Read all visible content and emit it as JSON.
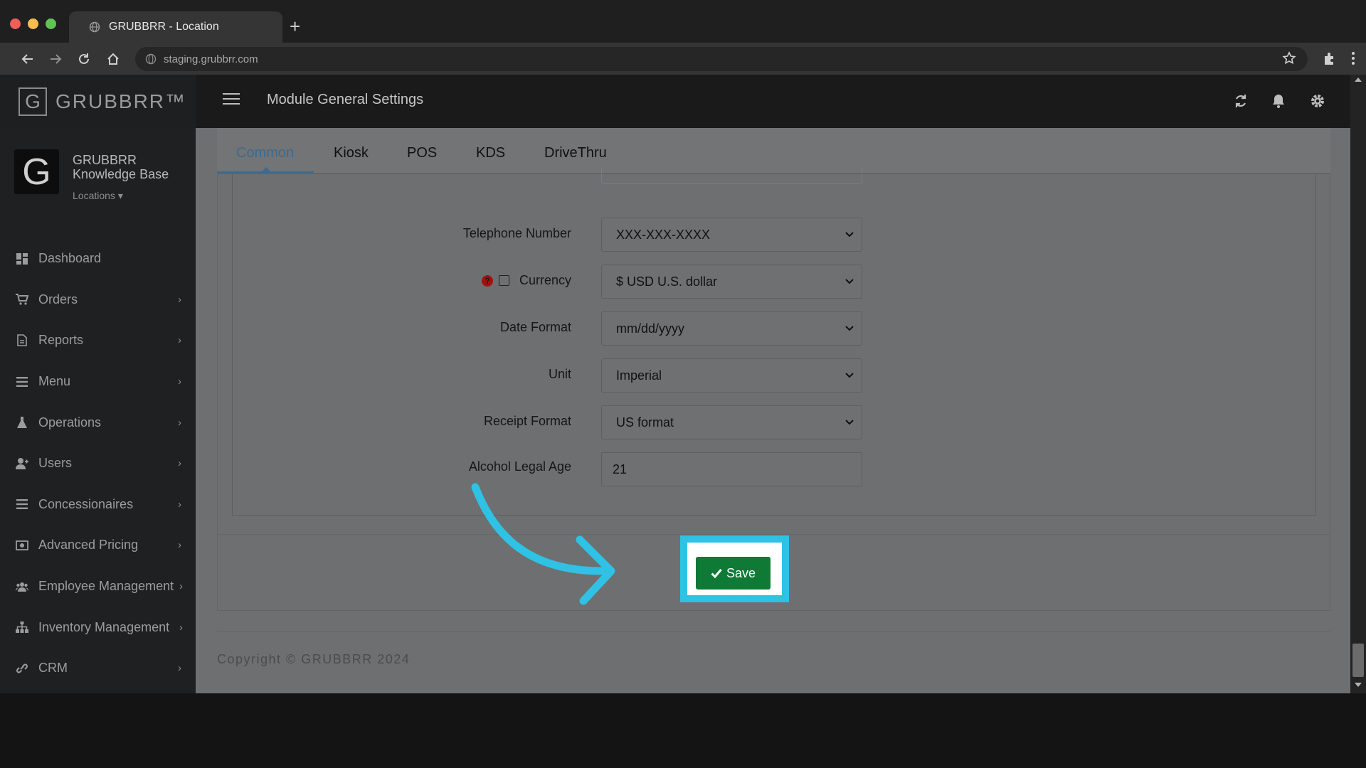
{
  "browser": {
    "tab_title": "GRUBBRR - Location",
    "new_tab": "+",
    "url": "staging.grubbrr.com"
  },
  "header": {
    "logo_letter": "G",
    "logo_text": "GRUBBRR™",
    "title": "Module General Settings"
  },
  "profile": {
    "avatar_letter": "G",
    "name": "GRUBBRR Knowledge Base",
    "location_label": "Locations ▾"
  },
  "sidebar": {
    "items": [
      {
        "label": "Dashboard",
        "icon": "dashboard-icon",
        "chevron": ""
      },
      {
        "label": "Orders",
        "icon": "cart-icon",
        "chevron": "›"
      },
      {
        "label": "Reports",
        "icon": "file-icon",
        "chevron": "›"
      },
      {
        "label": "Menu",
        "icon": "list-icon",
        "chevron": "›"
      },
      {
        "label": "Operations",
        "icon": "flask-icon",
        "chevron": "›"
      },
      {
        "label": "Users",
        "icon": "user-icon",
        "chevron": "›"
      },
      {
        "label": "Concessionaires",
        "icon": "list-icon",
        "chevron": "›"
      },
      {
        "label": "Advanced Pricing",
        "icon": "money-icon",
        "chevron": "›"
      },
      {
        "label": "Employee Management",
        "icon": "users-icon",
        "chevron": "›"
      },
      {
        "label": "Inventory Management",
        "icon": "sitemap-icon",
        "chevron": "›"
      },
      {
        "label": "CRM",
        "icon": "link-icon",
        "chevron": "›"
      }
    ]
  },
  "tabs": [
    "Common",
    "Kiosk",
    "POS",
    "KDS",
    "DriveThru"
  ],
  "active_tab": "Common",
  "form": {
    "telephone": {
      "label": "Telephone Number",
      "value": "XXX-XXX-XXXX"
    },
    "currency": {
      "label": "Currency",
      "value": "$ USD U.S. dollar",
      "help": "?"
    },
    "date_format": {
      "label": "Date Format",
      "value": "mm/dd/yyyy"
    },
    "unit": {
      "label": "Unit",
      "value": "Imperial"
    },
    "receipt_format": {
      "label": "Receipt Format",
      "value": "US format"
    },
    "alcohol_age": {
      "label": "Alcohol Legal Age",
      "value": "21"
    }
  },
  "save_label": "Save",
  "footer": "Copyright © GRUBBRR 2024",
  "colors": {
    "accent_highlight": "#2fc2e4",
    "save_green": "#0f7a36",
    "active_tab": "#3d6a8f",
    "help_red": "#a31010"
  }
}
